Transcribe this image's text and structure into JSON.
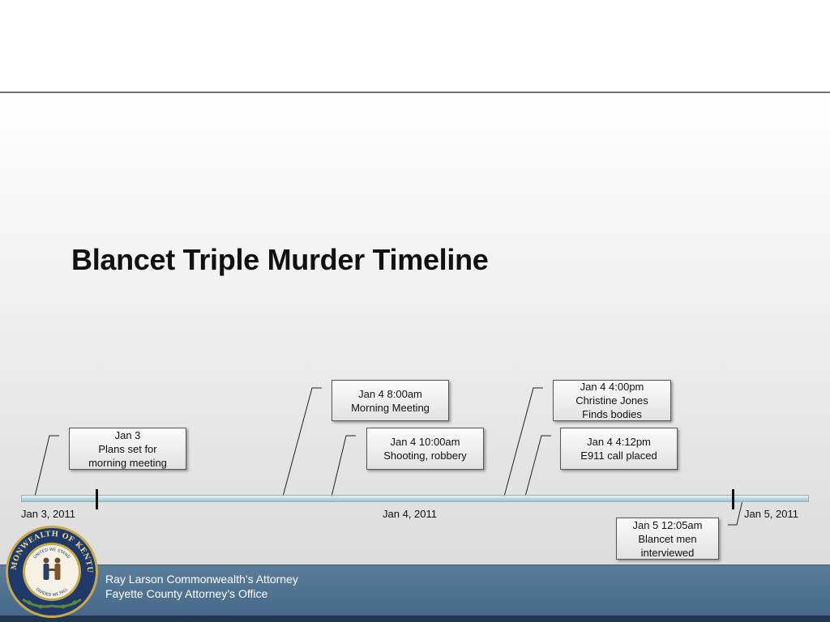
{
  "slide": {
    "title": "Blancet Triple Murder Timeline"
  },
  "timeline": {
    "axis_labels": [
      "Jan 3, 2011",
      "Jan 4, 2011",
      "Jan 5, 2011"
    ],
    "events": [
      {
        "lines": [
          "Jan 3",
          "Plans set for",
          "morning meeting"
        ]
      },
      {
        "lines": [
          "Jan 4 8:00am",
          "Morning Meeting"
        ]
      },
      {
        "lines": [
          "Jan 4 10:00am",
          "Shooting, robbery"
        ]
      },
      {
        "lines": [
          "Jan 4 4:00pm",
          "Christine Jones",
          "Finds bodies"
        ]
      },
      {
        "lines": [
          "Jan 4 4:12pm",
          "E911 call placed"
        ]
      },
      {
        "lines": [
          "Jan 5 12:05am",
          "Blancet men",
          "interviewed"
        ]
      }
    ]
  },
  "footer": {
    "line1": "Ray Larson Commonwealth’s Attorney",
    "line2": "Fayette County Attorney’s Office"
  },
  "seal": {
    "ring_text_top": "COMMONWEALTH OF KENTUCKY",
    "inner_text_top": "UNITED WE STAND",
    "inner_text_bottom": "DIVIDED WE FALL"
  },
  "colors": {
    "footer_blue": "#4f7191",
    "seal_navy": "#1f3a6a",
    "seal_gold": "#c9a84a",
    "axis_blue": "#b9d8e0"
  }
}
